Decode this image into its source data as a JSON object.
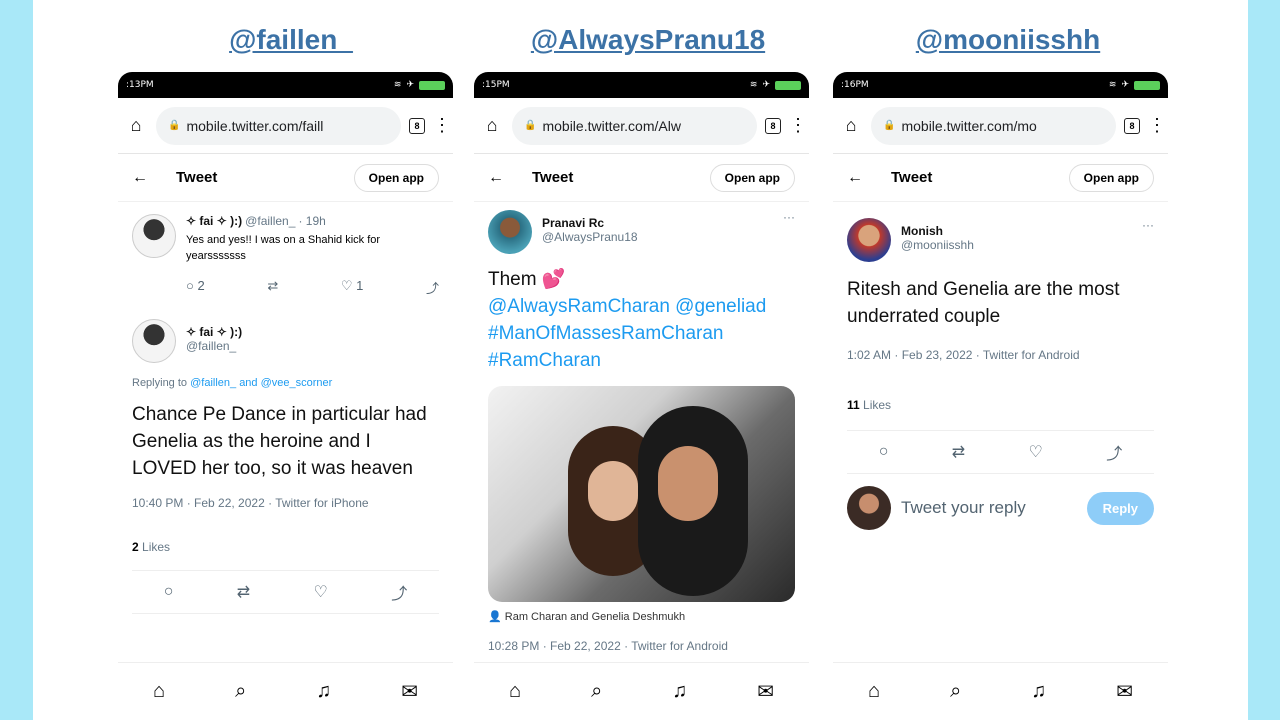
{
  "panels": [
    {
      "handle": "@faillen_",
      "status_time": ":13PM",
      "url": "mobile.twitter.com/faill",
      "tab_count": "8",
      "header_title": "Tweet",
      "open_app": "Open app",
      "parent_tweet": {
        "name": "✧ fai ✧ ):)",
        "username": "@faillen_",
        "time": "· 19h",
        "text": "Yes and yes!! I was on a Shahid kick for yearsssssss",
        "replies": "2",
        "likes": "1"
      },
      "tweet": {
        "name": "✧ fai ✧ ):)",
        "username": "@faillen_",
        "replying_to_prefix": "Replying to",
        "replying_to": "@faillen_ and @vee_scorner",
        "text": "Chance Pe Dance in particular had Genelia as the heroine and I LOVED her too, so it was heaven",
        "timestamp": "10:40 PM · Feb 22, 2022 · Twitter for iPhone",
        "likes_count": "2",
        "likes_label": "Likes"
      }
    },
    {
      "handle": "@AlwaysPranu18",
      "status_time": ":15PM",
      "url": "mobile.twitter.com/Alw",
      "tab_count": "8",
      "header_title": "Tweet",
      "open_app": "Open app",
      "tweet": {
        "name": "Pranavi Rc",
        "username": "@AlwaysPranu18",
        "text": "Them 💕",
        "mentions": "@AlwaysRamCharan @geneliad",
        "hashtags1": "#ManOfMassesRamCharan",
        "hashtags2": "#RamCharan",
        "tagged": "Ram Charan and Genelia Deshmukh",
        "timestamp": "10:28 PM · Feb 22, 2022 · Twitter for Android"
      }
    },
    {
      "handle": "@mooniisshh",
      "status_time": ":16PM",
      "url": "mobile.twitter.com/mo",
      "tab_count": "8",
      "header_title": "Tweet",
      "open_app": "Open app",
      "tweet": {
        "name": "Monish",
        "username": "@mooniisshh",
        "text": "Ritesh and Genelia are the most underrated couple",
        "timestamp": "1:02 AM · Feb 23, 2022 · Twitter for Android",
        "likes_count": "11",
        "likes_label": "Likes",
        "reply_placeholder": "Tweet your reply",
        "reply_button": "Reply"
      }
    }
  ]
}
